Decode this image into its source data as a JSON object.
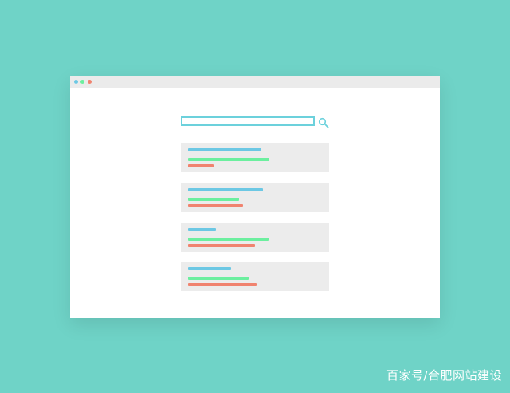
{
  "colors": {
    "background": "#6fd3c7",
    "window": "#ffffff",
    "title_bar": "#ebebeb",
    "card": "#ececec",
    "title_bar_text": "#6cc8e4",
    "url_bar_text": "#6cef9f",
    "snippet_bar_text": "#f0836f",
    "search_accent": "#6cd1dc"
  },
  "window_controls": [
    {
      "name": "blue-dot",
      "color": "#6cc8e4"
    },
    {
      "name": "green-dot",
      "color": "#6cef9f"
    },
    {
      "name": "red-dot",
      "color": "#f0836f"
    }
  ],
  "search": {
    "value": "",
    "placeholder": "",
    "icon": "search-icon"
  },
  "results": [
    {
      "title_fill": 0.55,
      "url_fill": 0.61,
      "snippet_fill": 0.19
    },
    {
      "title_fill": 0.56,
      "url_fill": 0.38,
      "snippet_fill": 0.41
    },
    {
      "title_fill": 0.21,
      "url_fill": 0.6,
      "snippet_fill": 0.5
    },
    {
      "title_fill": 0.32,
      "url_fill": 0.45,
      "snippet_fill": 0.51
    }
  ],
  "watermark": {
    "text": "百家号/合肥网站建设"
  }
}
